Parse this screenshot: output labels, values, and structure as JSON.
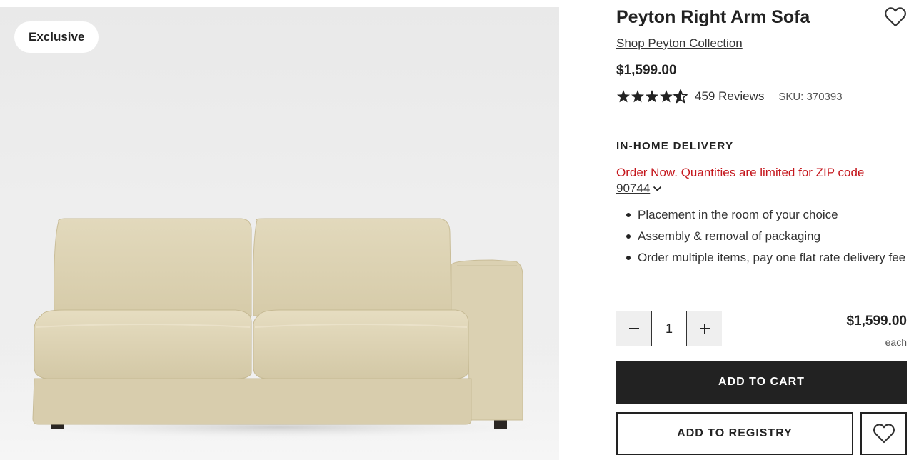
{
  "gallery": {
    "badge": "Exclusive"
  },
  "product": {
    "title": "Peyton Right Arm Sofa",
    "collection_link": "Shop Peyton Collection",
    "price": "$1,599.00",
    "rating": 4.5,
    "reviews_label": "459 Reviews",
    "sku_label": "SKU: 370393"
  },
  "delivery": {
    "heading": "IN-HOME DELIVERY",
    "notice": "Order Now. Quantities are limited for ZIP code",
    "zip": "90744",
    "bullets": [
      "Placement in the room of your choice",
      "Assembly & removal of packaging",
      "Order multiple items, pay one flat rate delivery fee"
    ]
  },
  "purchase": {
    "quantity": "1",
    "unit_price": "$1,599.00",
    "unit_label": "each",
    "add_to_cart": "ADD TO CART",
    "add_to_registry": "ADD TO REGISTRY"
  },
  "icons": {
    "favorite": "heart-outline-icon",
    "decrement": "minus-icon",
    "increment": "plus-icon",
    "zip_toggle": "chevron-down-icon"
  },
  "colors": {
    "notice_red": "#c4161c",
    "primary_button": "#222222",
    "qty_button_bg": "#efefef",
    "sofa_fabric": "#ddd3b4"
  }
}
